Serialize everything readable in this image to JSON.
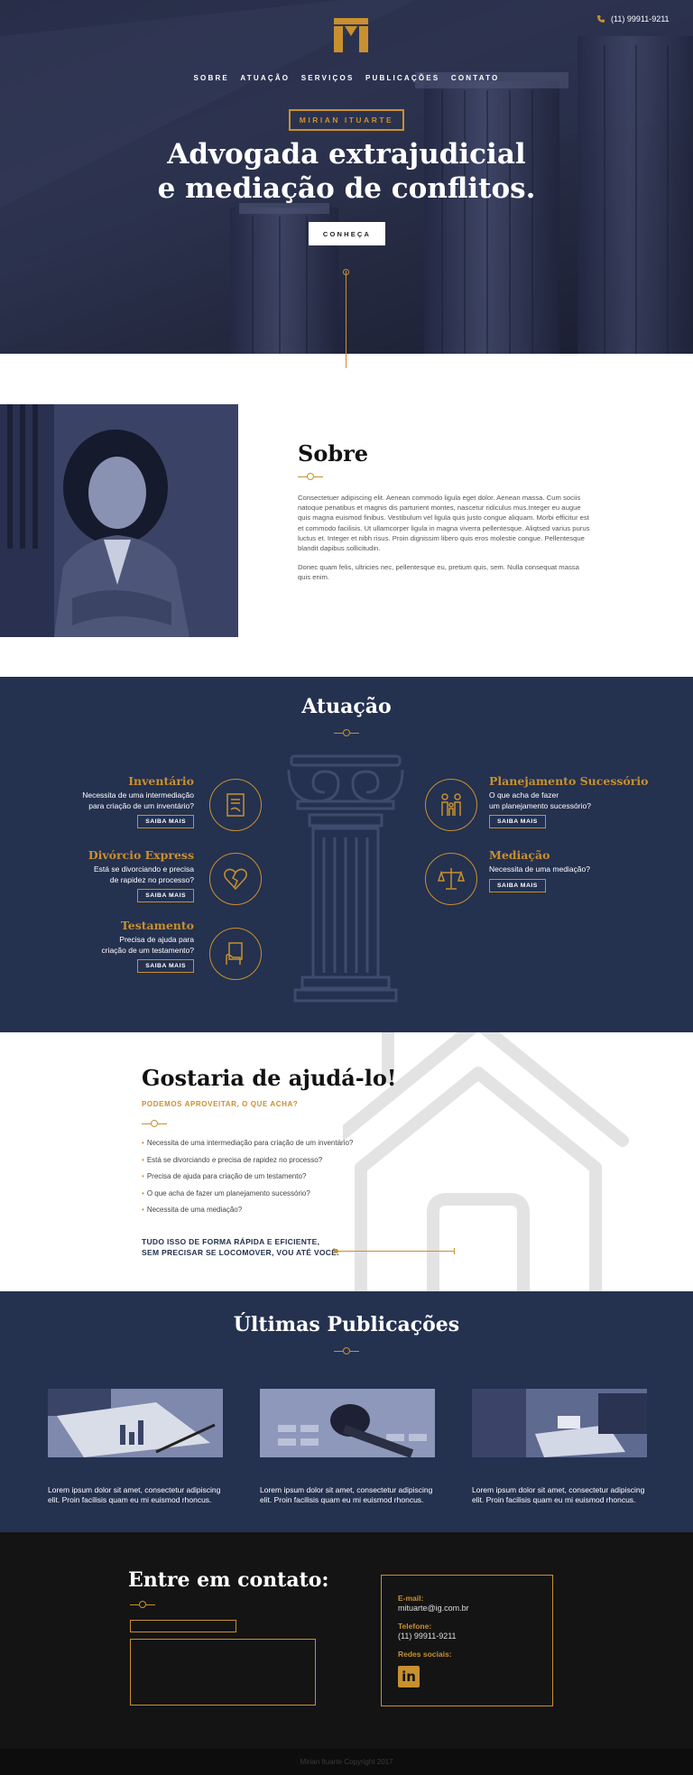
{
  "header": {
    "phone": "(11) 99911-9211",
    "nav": [
      "SOBRE",
      "ATUAÇÃO",
      "SERVIÇOS",
      "PUBLICAÇÕES",
      "CONTATO"
    ],
    "name_badge": "MIRIAN ITUARTE",
    "headline_line1": "Advogada extrajudicial",
    "headline_line2": "e mediação de conflitos.",
    "cta": "CONHEÇA"
  },
  "sobre": {
    "title": "Sobre",
    "paragraph1": "Consectetuer adipiscing elit. Aenean commodo ligula eget dolor. Aenean massa. Cum sociis natoque penatibus et magnis dis parturient montes, nascetur ridiculus mus.Integer eu augue quis magna euismod finibus. Vestibulum vel ligula quis justo congue aliquam. Morbi efficitur est et commodo facilisis. Ut ullamcorper ligula in magna viverra pellentesque. Aliqtsed varius purus luctus et. Integer et nibh risus. Proin dignissim libero quis eros molestie congue. Pellentesque blandit dapibus sollicitudin.",
    "paragraph2": "Donec quam felis, ultricies nec, pellentesque eu, pretium quis, sem. Nulla consequat massa quis enim."
  },
  "atuacao": {
    "title": "Atuação",
    "button_label": "SAIBA MAIS",
    "left": [
      {
        "title": "Inventário",
        "desc1": "Necessita de uma intermediação",
        "desc2": "para criação de um inventário?",
        "icon": "document-icon"
      },
      {
        "title": "Divórcio Express",
        "desc1": "Está se divorciando e precisa",
        "desc2": "de rapidez no processo?",
        "icon": "broken-heart-icon"
      },
      {
        "title": "Testamento",
        "desc1": "Precisa de ajuda para",
        "desc2": "criação de um testamento?",
        "icon": "hand-document-icon"
      }
    ],
    "right": [
      {
        "title": "Planejamento Sucessório",
        "desc1": "O que acha de fazer",
        "desc2": "um planejamento sucessório?",
        "icon": "family-icon"
      },
      {
        "title": "Mediação",
        "desc1": "Necessita de uma mediação?",
        "desc2": "",
        "icon": "scales-icon"
      }
    ]
  },
  "ajuda": {
    "title": "Gostaria de ajudá-lo!",
    "subtitle": "PODEMOS APROVEITAR, O QUE ACHA?",
    "items": [
      "Necessita de uma intermediação para criação de um inventário?",
      "Está se divorciando e precisa de rapidez no processo?",
      "Precisa de ajuda para criação de um testamento?",
      "O que acha de fazer um planejamento sucessório?",
      "Necessita de uma mediação?"
    ],
    "final_line1": "TUDO ISSO DE FORMA RÁPIDA E EFICIENTE,",
    "final_line2": "SEM PRECISAR SE LOCOMOVER, VOU ATÉ VOCÊ."
  },
  "publicacoes": {
    "title": "Últimas Publicações",
    "posts": [
      {
        "text": "Lorem ipsum dolor sit amet, consectetur adipiscing elit. Proin facilisis quam eu mi euismod rhoncus.",
        "image": "finance-document-image"
      },
      {
        "text": "Lorem ipsum dolor sit amet, consectetur adipiscing elit. Proin facilisis quam eu mi euismod rhoncus.",
        "image": "gavel-image"
      },
      {
        "text": "Lorem ipsum dolor sit amet, consectetur adipiscing elit. Proin facilisis quam eu mi euismod rhoncus.",
        "image": "meeting-image"
      }
    ]
  },
  "contato": {
    "title": "Entre em contato:",
    "email_label": "E-mail:",
    "email": "mituarte@ig.com.br",
    "phone_label": "Telefone:",
    "phone": "(11) 99911-9211",
    "social_label": "Redes sociais:",
    "social_icon": "linkedin-icon"
  },
  "footer": {
    "copyright": "Mirian Ituarte Copyright 2017"
  },
  "colors": {
    "accent": "#c8902f",
    "navy": "#24314f",
    "dark": "#141414"
  }
}
